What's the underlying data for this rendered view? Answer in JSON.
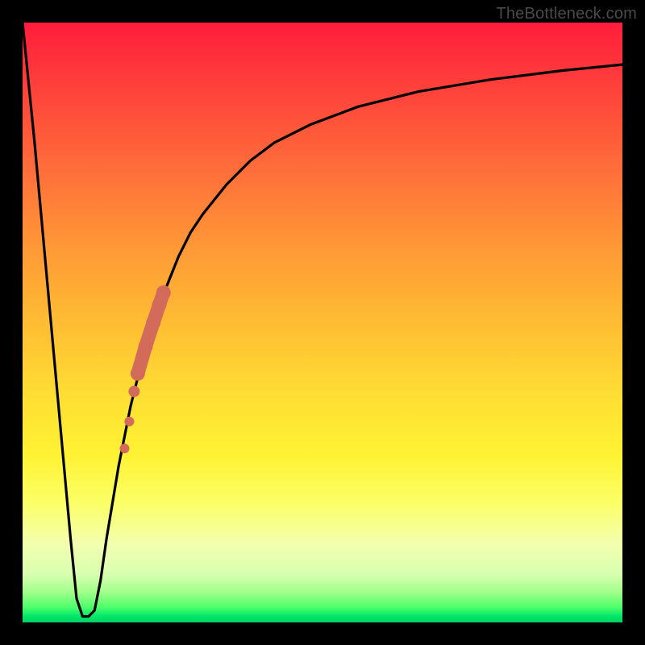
{
  "watermark": "TheBottleneck.com",
  "colors": {
    "frame": "#000000",
    "curve": "#000000",
    "markers": "#d36b5b",
    "gradient_top": "#ff1d3b",
    "gradient_bottom": "#00d060"
  },
  "chart_data": {
    "type": "line",
    "title": "",
    "xlabel": "",
    "ylabel": "",
    "xlim": [
      0,
      100
    ],
    "ylim": [
      0,
      100
    ],
    "grid": false,
    "legend": false,
    "series": [
      {
        "name": "bottleneck-curve",
        "x": [
          0,
          2,
          4,
          6,
          8,
          9,
          10,
          11,
          12,
          13,
          14,
          16,
          18,
          20,
          22,
          24,
          26,
          28,
          30,
          34,
          38,
          42,
          48,
          56,
          66,
          78,
          90,
          100
        ],
        "y": [
          100,
          80,
          58,
          36,
          14,
          4,
          1,
          1,
          2,
          7,
          14,
          26,
          36,
          44,
          51,
          56,
          61,
          65,
          68,
          73,
          77,
          80,
          83,
          86,
          88.5,
          90.5,
          92,
          93
        ]
      }
    ],
    "markers": {
      "name": "highlighted-points",
      "x": [
        23.5,
        22.8,
        21.8,
        20.5,
        19.2,
        18.6,
        17.8,
        17.0
      ],
      "y": [
        55.0,
        53.0,
        50.0,
        46.0,
        41.5,
        38.5,
        33.5,
        29.0
      ],
      "size": [
        9,
        9,
        9,
        9,
        9,
        7,
        6,
        6
      ]
    }
  }
}
